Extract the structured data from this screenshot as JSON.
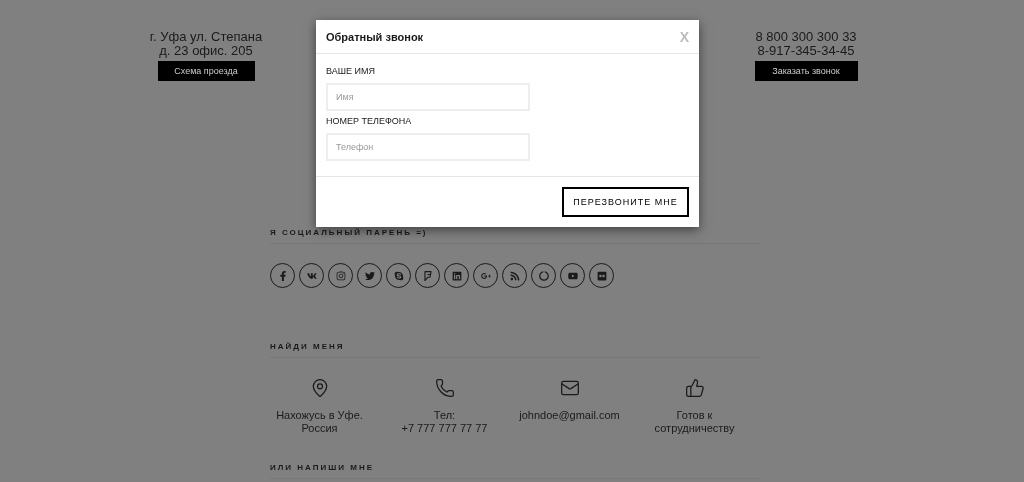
{
  "header": {
    "address": [
      "г. Уфа ул. Степана",
      "д. 23 офис. 205"
    ],
    "route_button": "Схема проезда",
    "phones": [
      "8 800 300 300 33",
      "8-917-345-34-45"
    ],
    "callback_button": "Заказать звонок"
  },
  "social": {
    "heading": "Я СОЦИАЛЬНЫЙ ПАРЕНЬ =)",
    "icons": [
      {
        "kind": "facebook"
      },
      {
        "kind": "vk"
      },
      {
        "kind": "instagram"
      },
      {
        "kind": "twitter"
      },
      {
        "kind": "skype"
      },
      {
        "kind": "foursquare"
      },
      {
        "kind": "linkedin"
      },
      {
        "kind": "googleplus"
      },
      {
        "kind": "rss"
      },
      {
        "kind": "ring"
      },
      {
        "kind": "youtube"
      },
      {
        "kind": "flickr"
      }
    ]
  },
  "find_me": {
    "heading": "НАЙДИ МЕНЯ",
    "items": [
      {
        "kind": "location",
        "lines": [
          "Нахожусь в Уфе.",
          "Россия"
        ]
      },
      {
        "kind": "phone",
        "lines": [
          "Тел:",
          "+7 777 777 77 77"
        ]
      },
      {
        "kind": "mail",
        "lines": [
          "johndoe@gmail.com"
        ]
      },
      {
        "kind": "like",
        "lines": [
          "Готов к",
          "сотрудничеству"
        ]
      }
    ]
  },
  "write_me": {
    "heading": "ИЛИ НАПИШИ МНЕ"
  },
  "modal": {
    "title": "Обратный звонок",
    "close": "X",
    "fields": [
      {
        "label": "ВАШЕ ИМЯ",
        "placeholder": "Имя"
      },
      {
        "label": "НОМЕР ТЕЛЕФОНА",
        "placeholder": "Телефон"
      }
    ],
    "submit": "ПЕРЕЗВОНИТЕ МНЕ"
  }
}
